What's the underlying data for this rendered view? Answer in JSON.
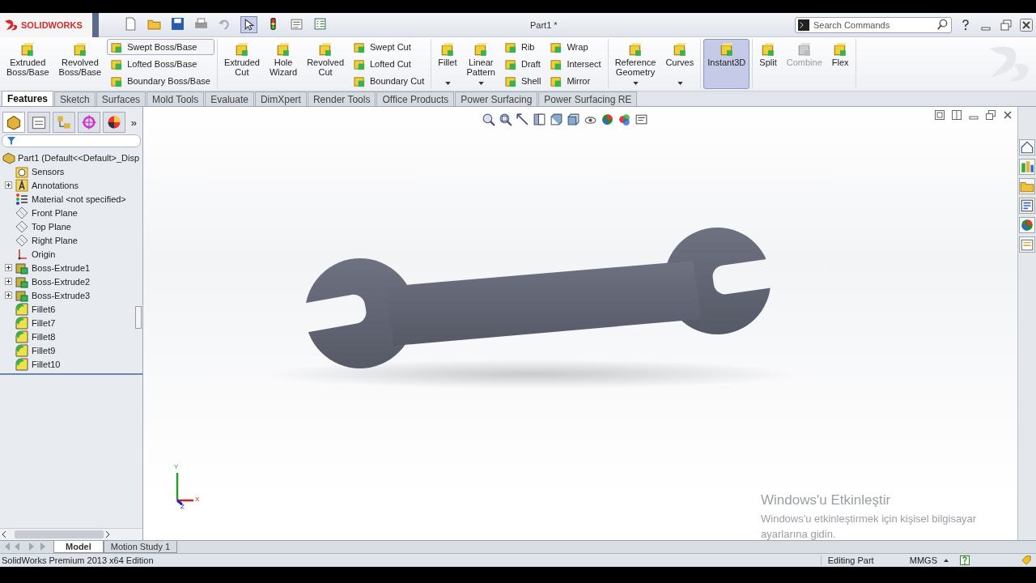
{
  "app": {
    "logo_text": "SOLIDWORKS",
    "title": "Part1 *"
  },
  "search": {
    "placeholder": "Search Commands"
  },
  "ribbon": [
    {
      "controls": [
        {
          "kind": "large",
          "label": "Extruded Boss/Base",
          "selected": false,
          "disabled": false,
          "dropdown": false
        },
        {
          "kind": "large",
          "label": "Revolved Boss/Base",
          "selected": false,
          "disabled": false,
          "dropdown": false
        },
        {
          "kind": "stack",
          "buttons": [
            {
              "label": "Swept Boss/Base",
              "selected": true
            },
            {
              "label": "Lofted Boss/Base",
              "selected": false
            },
            {
              "label": "Boundary Boss/Base",
              "selected": false
            }
          ]
        }
      ]
    },
    {
      "controls": [
        {
          "kind": "large",
          "label": "Extruded Cut",
          "selected": false,
          "disabled": false,
          "dropdown": false
        },
        {
          "kind": "large",
          "label": "Hole Wizard",
          "selected": false,
          "disabled": false,
          "dropdown": false
        },
        {
          "kind": "large",
          "label": "Revolved Cut",
          "selected": false,
          "disabled": false,
          "dropdown": false
        },
        {
          "kind": "stack",
          "buttons": [
            {
              "label": "Swept Cut",
              "selected": false
            },
            {
              "label": "Lofted Cut",
              "selected": false
            },
            {
              "label": "Boundary Cut",
              "selected": false
            }
          ]
        }
      ]
    },
    {
      "controls": [
        {
          "kind": "large",
          "label": "Fillet",
          "selected": false,
          "disabled": false,
          "dropdown": true
        },
        {
          "kind": "large",
          "label": "Linear Pattern",
          "selected": false,
          "disabled": false,
          "dropdown": true
        },
        {
          "kind": "stack",
          "buttons": [
            {
              "label": "Rib",
              "selected": false
            },
            {
              "label": "Draft",
              "selected": false
            },
            {
              "label": "Shell",
              "selected": false
            }
          ]
        },
        {
          "kind": "stack",
          "buttons": [
            {
              "label": "Wrap",
              "selected": false
            },
            {
              "label": "Intersect",
              "selected": false
            },
            {
              "label": "Mirror",
              "selected": false
            }
          ]
        }
      ]
    },
    {
      "controls": [
        {
          "kind": "large",
          "label": "Reference Geometry",
          "selected": false,
          "disabled": false,
          "dropdown": true
        },
        {
          "kind": "large",
          "label": "Curves",
          "selected": false,
          "disabled": false,
          "dropdown": true
        }
      ]
    },
    {
      "controls": [
        {
          "kind": "large",
          "label": "Instant3D",
          "selected": true,
          "disabled": false,
          "dropdown": false
        }
      ]
    },
    {
      "controls": [
        {
          "kind": "large",
          "label": "Split",
          "selected": false,
          "disabled": false,
          "dropdown": false
        },
        {
          "kind": "large",
          "label": "Combine",
          "selected": false,
          "disabled": true,
          "dropdown": false
        },
        {
          "kind": "large",
          "label": "Flex",
          "selected": false,
          "disabled": false,
          "dropdown": false
        }
      ]
    }
  ],
  "tabs": [
    {
      "label": "Features",
      "selected": true
    },
    {
      "label": "Sketch",
      "selected": false
    },
    {
      "label": "Surfaces",
      "selected": false
    },
    {
      "label": "Mold Tools",
      "selected": false
    },
    {
      "label": "Evaluate",
      "selected": false
    },
    {
      "label": "DimXpert",
      "selected": false
    },
    {
      "label": "Render Tools",
      "selected": false
    },
    {
      "label": "Office Products",
      "selected": false
    },
    {
      "label": "Power Surfacing",
      "selected": false
    },
    {
      "label": "Power Surfacing RE",
      "selected": false
    }
  ],
  "panel": {
    "more": "»",
    "tree": {
      "label": "Part1  (Default<<Default>_Disp",
      "kind": "part",
      "children": [
        {
          "label": "Sensors",
          "kind": "sensor",
          "expandable": false
        },
        {
          "label": "Annotations",
          "kind": "annotation",
          "expandable": true
        },
        {
          "label": "Material <not specified>",
          "kind": "material",
          "expandable": false
        },
        {
          "label": "Front Plane",
          "kind": "plane",
          "expandable": false
        },
        {
          "label": "Top Plane",
          "kind": "plane",
          "expandable": false
        },
        {
          "label": "Right Plane",
          "kind": "plane",
          "expandable": false
        },
        {
          "label": "Origin",
          "kind": "origin",
          "expandable": false
        },
        {
          "label": "Boss-Extrude1",
          "kind": "extrude",
          "expandable": true
        },
        {
          "label": "Boss-Extrude2",
          "kind": "extrude",
          "expandable": true
        },
        {
          "label": "Boss-Extrude3",
          "kind": "extrude",
          "expandable": true
        },
        {
          "label": "Fillet6",
          "kind": "fillet",
          "expandable": false
        },
        {
          "label": "Fillet7",
          "kind": "fillet",
          "expandable": false
        },
        {
          "label": "Fillet8",
          "kind": "fillet",
          "expandable": false
        },
        {
          "label": "Fillet9",
          "kind": "fillet",
          "expandable": false
        },
        {
          "label": "Fillet10",
          "kind": "fillet",
          "expandable": false
        }
      ]
    }
  },
  "triad": {
    "x_label": "X",
    "y_label": "Y",
    "z_label": "Z"
  },
  "activation": {
    "title": "Windows'u Etkinleştir",
    "message": "Windows'u etkinleştirmek için kişisel bilgisayar ayarlarına gidin."
  },
  "bottom_tabs": [
    {
      "label": "Model",
      "selected": true
    },
    {
      "label": "Motion Study 1",
      "selected": false
    }
  ],
  "status_bar": {
    "edition": "SolidWorks Premium 2013 x64 Edition",
    "mode": "Editing Part",
    "units": "MMGS"
  }
}
